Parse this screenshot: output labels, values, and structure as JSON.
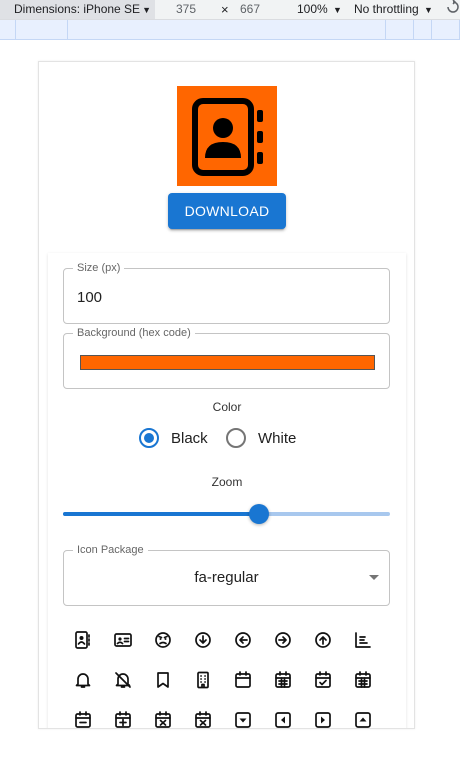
{
  "devtools": {
    "dimensions_label": "Dimensions: iPhone SE",
    "width": "375",
    "times": "×",
    "height": "667",
    "zoom": "100%",
    "throttling": "No throttling"
  },
  "preview": {
    "background_color": "#ff6600",
    "icon_color": "#000000",
    "icon": "address-book-icon"
  },
  "download_label": "DOWNLOAD",
  "form": {
    "size_label": "Size (px)",
    "size_value": "100",
    "background_label": "Background (hex code)",
    "background_value": "#ff6600",
    "color_label": "Color",
    "color_options": [
      "Black",
      "White"
    ],
    "color_selected": "Black",
    "zoom_label": "Zoom",
    "zoom_level": 0.6,
    "icon_package_label": "Icon Package",
    "icon_package_value": "fa-regular"
  },
  "icons": [
    "address-book-icon",
    "address-card-icon",
    "face-angry-icon",
    "circle-down-icon",
    "circle-left-icon",
    "circle-right-icon",
    "circle-up-icon",
    "chart-bar-icon",
    "bell-icon",
    "bell-slash-icon",
    "bookmark-icon",
    "building-icon",
    "calendar-icon",
    "calendar-days-icon",
    "calendar-check-icon",
    "calendar-grid-icon",
    "calendar-minus-icon",
    "calendar-plus-icon",
    "calendar-xmark-icon",
    "calendar-times-icon",
    "square-caret-down-icon",
    "square-caret-left-icon",
    "square-caret-right-icon",
    "square-caret-up-icon"
  ],
  "accent_color": "#1976d2"
}
